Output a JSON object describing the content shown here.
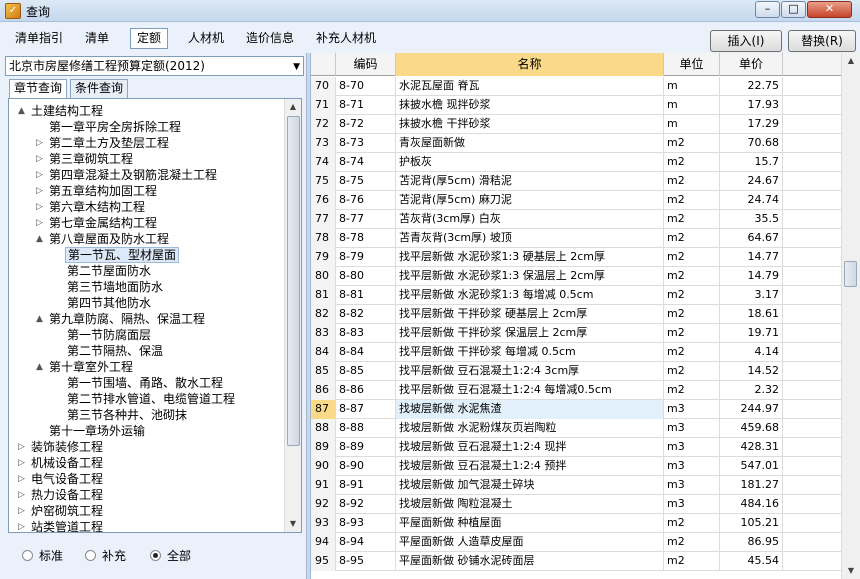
{
  "window": {
    "title": "查询",
    "min_glyph": "–",
    "max_glyph": "□",
    "close_glyph": "✕"
  },
  "toolbar": {
    "tabs": [
      "清单指引",
      "清单",
      "定额",
      "人材机",
      "造价信息",
      "补充人材机"
    ],
    "active_tab": "定额",
    "insert_label": "插入(I)",
    "replace_label": "替换(R)"
  },
  "left": {
    "library": "北京市房屋修缮工程预算定额(2012)",
    "tabs": [
      "章节查询",
      "条件查询"
    ],
    "tree": [
      {
        "label": "土建结构工程",
        "depth": 0,
        "toggle": "▲"
      },
      {
        "label": "第一章平房全房拆除工程",
        "depth": 1,
        "toggle": ""
      },
      {
        "label": "第二章土方及垫层工程",
        "depth": 1,
        "toggle": "▷"
      },
      {
        "label": "第三章砌筑工程",
        "depth": 1,
        "toggle": "▷"
      },
      {
        "label": "第四章混凝土及钢筋混凝土工程",
        "depth": 1,
        "toggle": "▷"
      },
      {
        "label": "第五章结构加固工程",
        "depth": 1,
        "toggle": "▷"
      },
      {
        "label": "第六章木结构工程",
        "depth": 1,
        "toggle": "▷"
      },
      {
        "label": "第七章金属结构工程",
        "depth": 1,
        "toggle": "▷"
      },
      {
        "label": "第八章屋面及防水工程",
        "depth": 1,
        "toggle": "▲"
      },
      {
        "label": "第一节瓦、型材屋面",
        "depth": 2,
        "toggle": "",
        "selected": true
      },
      {
        "label": "第二节屋面防水",
        "depth": 2,
        "toggle": ""
      },
      {
        "label": "第三节墙地面防水",
        "depth": 2,
        "toggle": ""
      },
      {
        "label": "第四节其他防水",
        "depth": 2,
        "toggle": ""
      },
      {
        "label": "第九章防腐、隔热、保温工程",
        "depth": 1,
        "toggle": "▲"
      },
      {
        "label": "第一节防腐面层",
        "depth": 2,
        "toggle": ""
      },
      {
        "label": "第二节隔热、保温",
        "depth": 2,
        "toggle": ""
      },
      {
        "label": "第十章室外工程",
        "depth": 1,
        "toggle": "▲"
      },
      {
        "label": "第一节围墙、甬路、散水工程",
        "depth": 2,
        "toggle": ""
      },
      {
        "label": "第二节排水管道、电缆管道工程",
        "depth": 2,
        "toggle": ""
      },
      {
        "label": "第三节各种井、池砌抹",
        "depth": 2,
        "toggle": ""
      },
      {
        "label": "第十一章场外运输",
        "depth": 1,
        "toggle": ""
      },
      {
        "label": "装饰装修工程",
        "depth": 0,
        "toggle": "▷"
      },
      {
        "label": "机械设备工程",
        "depth": 0,
        "toggle": "▷"
      },
      {
        "label": "电气设备工程",
        "depth": 0,
        "toggle": "▷"
      },
      {
        "label": "热力设备工程",
        "depth": 0,
        "toggle": "▷"
      },
      {
        "label": "炉窑砌筑工程",
        "depth": 0,
        "toggle": "▷"
      },
      {
        "label": "站类管道工程",
        "depth": 0,
        "toggle": "▷"
      }
    ],
    "radios": [
      {
        "label": "标准",
        "checked": false
      },
      {
        "label": "补充",
        "checked": false
      },
      {
        "label": "全部",
        "checked": true
      }
    ]
  },
  "grid": {
    "columns": [
      "",
      "编码",
      "名称",
      "单位",
      "单价"
    ],
    "active_column": "名称",
    "current_row": "87",
    "rows": [
      [
        "70",
        "8-70",
        "水泥瓦屋面 脊瓦",
        "m",
        "22.75"
      ],
      [
        "71",
        "8-71",
        "抹披水檐 现拌砂浆",
        "m",
        "17.93"
      ],
      [
        "72",
        "8-72",
        "抹披水檐 干拌砂浆",
        "m",
        "17.29"
      ],
      [
        "73",
        "8-73",
        "青灰屋面新做",
        "m2",
        "70.68"
      ],
      [
        "74",
        "8-74",
        "护板灰",
        "m2",
        "15.7"
      ],
      [
        "75",
        "8-75",
        "苫泥背(厚5cm) 滑秸泥",
        "m2",
        "24.67"
      ],
      [
        "76",
        "8-76",
        "苫泥背(厚5cm) 麻刀泥",
        "m2",
        "24.74"
      ],
      [
        "77",
        "8-77",
        "苫灰背(3cm厚) 白灰",
        "m2",
        "35.5"
      ],
      [
        "78",
        "8-78",
        "苫青灰背(3cm厚) 坡顶",
        "m2",
        "64.67"
      ],
      [
        "79",
        "8-79",
        "找平层新做 水泥砂浆1:3 硬基层上 2cm厚",
        "m2",
        "14.77"
      ],
      [
        "80",
        "8-80",
        "找平层新做 水泥砂浆1:3 保温层上 2cm厚",
        "m2",
        "14.79"
      ],
      [
        "81",
        "8-81",
        "找平层新做 水泥砂浆1:3 每增减 0.5cm",
        "m2",
        "3.17"
      ],
      [
        "82",
        "8-82",
        "找平层新做 干拌砂浆 硬基层上 2cm厚",
        "m2",
        "18.61"
      ],
      [
        "83",
        "8-83",
        "找平层新做 干拌砂浆 保温层上 2cm厚",
        "m2",
        "19.71"
      ],
      [
        "84",
        "8-84",
        "找平层新做 干拌砂浆 每增减 0.5cm",
        "m2",
        "4.14"
      ],
      [
        "85",
        "8-85",
        "找平层新做 豆石混凝土1:2:4 3cm厚",
        "m2",
        "14.52"
      ],
      [
        "86",
        "8-86",
        "找平层新做 豆石混凝土1:2:4 每增减0.5cm",
        "m2",
        "2.32"
      ],
      [
        "87",
        "8-87",
        "找坡层新做 水泥焦渣",
        "m3",
        "244.97"
      ],
      [
        "88",
        "8-88",
        "找坡层新做 水泥粉煤灰页岩陶粒",
        "m3",
        "459.68"
      ],
      [
        "89",
        "8-89",
        "找坡层新做 豆石混凝土1:2:4 现拌",
        "m3",
        "428.31"
      ],
      [
        "90",
        "8-90",
        "找坡层新做 豆石混凝土1:2:4 预拌",
        "m3",
        "547.01"
      ],
      [
        "91",
        "8-91",
        "找坡层新做 加气混凝土碎块",
        "m3",
        "181.27"
      ],
      [
        "92",
        "8-92",
        "找坡层新做 陶粒混凝土",
        "m3",
        "484.16"
      ],
      [
        "93",
        "8-93",
        "平屋面新做 种植屋面",
        "m2",
        "105.21"
      ],
      [
        "94",
        "8-94",
        "平屋面新做 人造草皮屋面",
        "m2",
        "86.95"
      ],
      [
        "95",
        "8-95",
        "平屋面新做 砂铺水泥砖面层",
        "m2",
        "45.54"
      ]
    ]
  }
}
